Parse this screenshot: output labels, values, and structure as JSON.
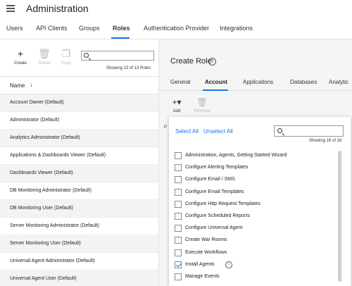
{
  "app": {
    "title": "Administration",
    "menu_icon": "hamburger-icon"
  },
  "main_nav": {
    "tabs": [
      {
        "label": "Users"
      },
      {
        "label": "API Clients"
      },
      {
        "label": "Groups"
      },
      {
        "label": "Roles",
        "active": true
      },
      {
        "label": "Authentication Provider"
      },
      {
        "label": "Integrations"
      }
    ],
    "accent": "#1a73e8"
  },
  "left_panel": {
    "toolbar": {
      "create": "Create",
      "delete": "Delete",
      "copy": "Copy"
    },
    "search": {
      "value": "",
      "placeholder": ""
    },
    "showing": "Showing 13 of 13 Roles",
    "column_header": "Name",
    "rows": [
      "Account Owner (Default)",
      "Administrator (Default)",
      "Analytics Administrator (Default)",
      "Applications & Dashboards Viewer (Default)",
      "Dashboards Viewer (Default)",
      "DB Monitoring Administrator (Default)",
      "DB Monitoring User (Default)",
      "Server Monitoring Administrator (Default)",
      "Server Monitoring User (Default)",
      "Universal Agent Administrator (Default)",
      "Universal Agent User (Default)"
    ]
  },
  "right_panel": {
    "title": "Create Role",
    "tabs": [
      {
        "label": "General"
      },
      {
        "label": "Account",
        "active": true
      },
      {
        "label": "Applications"
      },
      {
        "label": "Databases"
      },
      {
        "label": "Analytic"
      }
    ],
    "toolbar": {
      "add": "Add",
      "remove": "Remove"
    },
    "stub_label": "P"
  },
  "dropdown": {
    "select_all": "Select All",
    "unselect_all": "Unselect All",
    "search": {
      "value": "",
      "placeholder": ""
    },
    "showing": "Showing 16 of 16",
    "items": [
      {
        "label": "Administration, Agents, Getting Started Wizard",
        "checked": false
      },
      {
        "label": "Configure Alerting Templates",
        "checked": false
      },
      {
        "label": "Configure Email / SMS",
        "checked": false
      },
      {
        "label": "Configure Email Templates",
        "checked": false
      },
      {
        "label": "Configure Http Request Templates",
        "checked": false
      },
      {
        "label": "Configure Scheduled Reports",
        "checked": false
      },
      {
        "label": "Configure Universal Agent",
        "checked": false
      },
      {
        "label": "Create War Rooms",
        "checked": false
      },
      {
        "label": "Execute Workflows",
        "checked": false
      },
      {
        "label": "Install Agents",
        "checked": true,
        "info": true
      },
      {
        "label": "Manage Events",
        "checked": false
      }
    ]
  }
}
